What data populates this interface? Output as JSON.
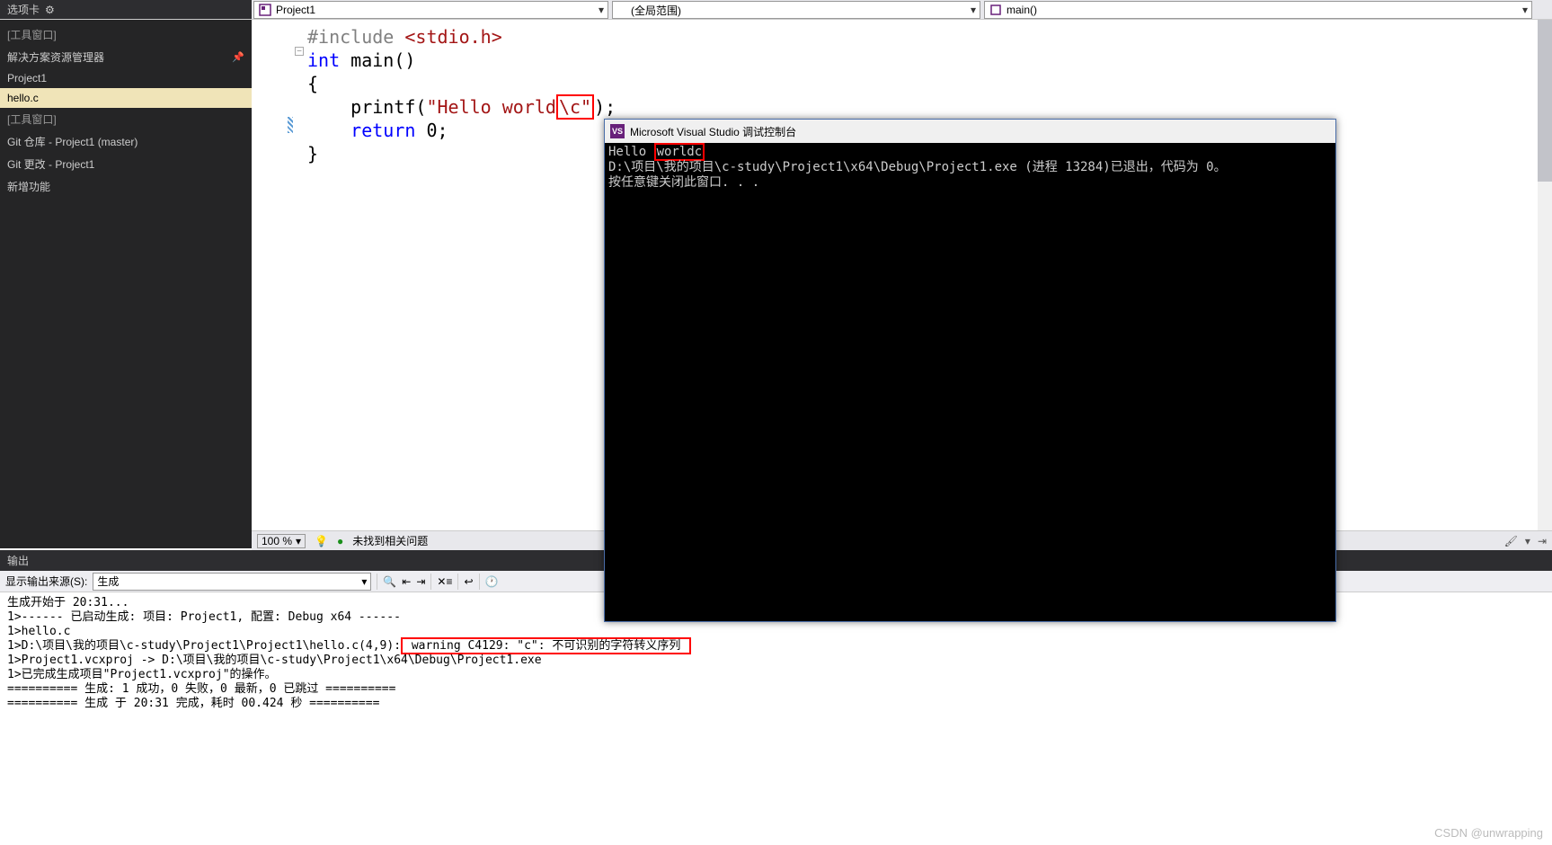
{
  "toolbar": {
    "tab_label": "选项卡",
    "project_dropdown": "Project1",
    "scope_dropdown": "(全局范围)",
    "function_dropdown": "main()"
  },
  "sidebar": {
    "section1": "[工具窗口]",
    "explorer": "解决方案资源管理器",
    "project": "Project1",
    "file": "hello.c",
    "section2": "[工具窗口]",
    "git_repo": "Git 仓库 - Project1 (master)",
    "git_changes": "Git 更改 - Project1",
    "new_feature": "新增功能"
  },
  "code": {
    "line1_inc": "#include ",
    "line1_hdr": "<stdio.h>",
    "line2_kw": "int",
    "line2_func": " main()",
    "line3": "{",
    "line4_indent": "    printf(",
    "line4_str1": "\"Hello world",
    "line4_esc": "\\c",
    "line4_str2": "\"",
    "line4_end": ");",
    "line5_indent": "    ",
    "line5_kw": "return",
    "line5_end": " 0;",
    "line6": "}"
  },
  "status": {
    "zoom": "100 %",
    "issues": "未找到相关问题"
  },
  "output": {
    "title": "输出",
    "source_label": "显示输出来源(S):",
    "source_value": "生成",
    "line1": "生成开始于 20:31...",
    "line2": "1>------ 已启动生成: 项目: Project1, 配置: Debug x64 ------",
    "line3": "1>hello.c",
    "line4_pre": "1>D:\\项目\\我的项目\\c-study\\Project1\\Project1\\hello.c(4,9):",
    "line4_warn": " warning C4129: \"c\": 不可识别的字符转义序列 ",
    "line5": "1>Project1.vcxproj -> D:\\项目\\我的项目\\c-study\\Project1\\x64\\Debug\\Project1.exe",
    "line6": "1>已完成生成项目\"Project1.vcxproj\"的操作。",
    "line7": "========== 生成: 1 成功，0 失败，0 最新，0 已跳过 ==========",
    "line8": "========== 生成 于 20:31 完成，耗时 00.424 秒 =========="
  },
  "console": {
    "title": "Microsoft Visual Studio 调试控制台",
    "line1_pre": "Hello ",
    "line1_boxed": "worldc",
    "line2": "D:\\项目\\我的项目\\c-study\\Project1\\x64\\Debug\\Project1.exe (进程 13284)已退出，代码为 0。",
    "line3": "按任意键关闭此窗口. . ."
  },
  "watermark": "CSDN @unwrapping"
}
